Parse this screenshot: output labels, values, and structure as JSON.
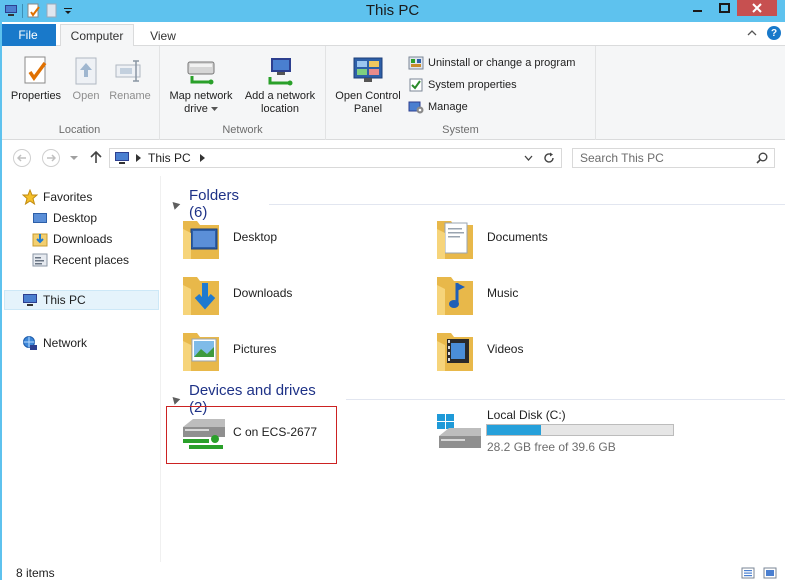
{
  "window": {
    "title": "This PC"
  },
  "ribbon": {
    "tabs": {
      "file": "File",
      "computer": "Computer",
      "view": "View"
    },
    "location": {
      "label": "Location",
      "properties": "Properties",
      "open": "Open",
      "rename": "Rename"
    },
    "network": {
      "label": "Network",
      "map_drive_line1": "Map network",
      "map_drive_line2": "drive",
      "add_location_line1": "Add a network",
      "add_location_line2": "location"
    },
    "system": {
      "label": "System",
      "open_cp_line1": "Open Control",
      "open_cp_line2": "Panel",
      "uninstall": "Uninstall or change a program",
      "sys_props": "System properties",
      "manage": "Manage"
    }
  },
  "address": {
    "path": "This PC",
    "search_placeholder": "Search This PC"
  },
  "nav": {
    "favorites": "Favorites",
    "desktop": "Desktop",
    "downloads": "Downloads",
    "recent": "Recent places",
    "thispc": "This PC",
    "network": "Network"
  },
  "folders_group": "Folders (6)",
  "folders": {
    "desktop": "Desktop",
    "documents": "Documents",
    "downloads": "Downloads",
    "music": "Music",
    "pictures": "Pictures",
    "videos": "Videos"
  },
  "drives_group": "Devices and drives (2)",
  "drives": {
    "network_drive": "C on ECS-2677",
    "local": {
      "name": "Local Disk (C:)",
      "free": "28.2 GB free of 39.6 GB",
      "used_fraction": 0.288
    }
  },
  "status": {
    "items": "8 items"
  },
  "colors": {
    "accent": "#1979ca",
    "titlebar": "#5ec2ee",
    "group_header": "#1e3287",
    "progress": "#26a0da"
  }
}
